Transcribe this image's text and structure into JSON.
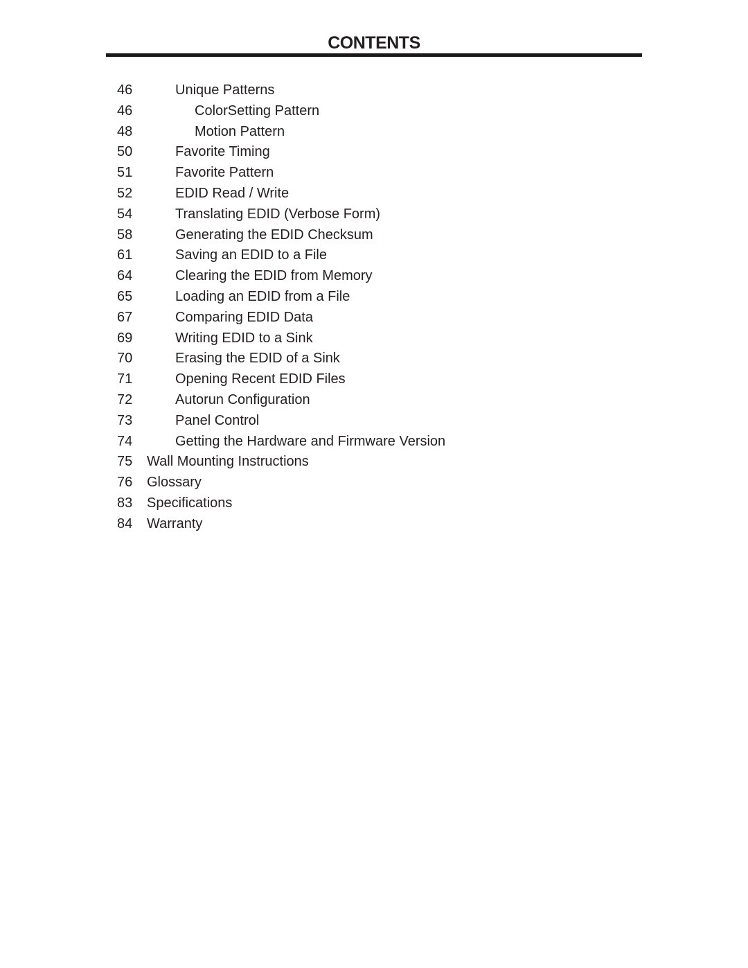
{
  "page": {
    "title": "CONTENTS"
  },
  "toc": {
    "entries": [
      {
        "page": "46",
        "label": "Unique Patterns",
        "level": 2
      },
      {
        "page": "46",
        "label": "ColorSetting Pattern",
        "level": 3
      },
      {
        "page": "48",
        "label": "Motion Pattern",
        "level": 3
      },
      {
        "page": "50",
        "label": "Favorite Timing",
        "level": 2
      },
      {
        "page": "51",
        "label": "Favorite Pattern",
        "level": 2
      },
      {
        "page": "52",
        "label": "EDID Read / Write",
        "level": 2
      },
      {
        "page": "54",
        "label": "Translating EDID (Verbose Form)",
        "level": 2
      },
      {
        "page": "58",
        "label": "Generating the EDID Checksum",
        "level": 2
      },
      {
        "page": "61",
        "label": "Saving an EDID to a File",
        "level": 2
      },
      {
        "page": "64",
        "label": "Clearing the EDID from Memory",
        "level": 2
      },
      {
        "page": "65",
        "label": "Loading an EDID from a File",
        "level": 2
      },
      {
        "page": "67",
        "label": "Comparing EDID Data",
        "level": 2
      },
      {
        "page": "69",
        "label": "Writing EDID to a Sink",
        "level": 2
      },
      {
        "page": "70",
        "label": "Erasing the EDID of a Sink",
        "level": 2
      },
      {
        "page": "71",
        "label": "Opening Recent EDID Files",
        "level": 2
      },
      {
        "page": "72",
        "label": "Autorun Configuration",
        "level": 2
      },
      {
        "page": "73",
        "label": "Panel Control",
        "level": 2
      },
      {
        "page": "74",
        "label": "Getting the Hardware and Firmware Version",
        "level": 2
      },
      {
        "page": "75",
        "label": "Wall Mounting Instructions",
        "level": 1
      },
      {
        "page": "76",
        "label": "Glossary",
        "level": 1
      },
      {
        "page": "83",
        "label": "Specifications",
        "level": 1
      },
      {
        "page": "84",
        "label": "Warranty",
        "level": 1
      }
    ]
  }
}
